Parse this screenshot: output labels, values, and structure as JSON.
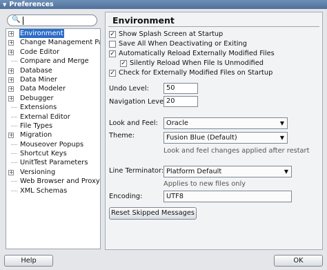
{
  "window": {
    "title": "Preferences"
  },
  "search": {
    "icon": "binoculars-icon",
    "value": ""
  },
  "tree": {
    "nodes": [
      {
        "label": "Environment",
        "expandable": true,
        "selected": true
      },
      {
        "label": "Change Management Param",
        "expandable": true
      },
      {
        "label": "Code Editor",
        "expandable": true
      },
      {
        "label": "Compare and Merge",
        "expandable": false
      },
      {
        "label": "Database",
        "expandable": true
      },
      {
        "label": "Data Miner",
        "expandable": true
      },
      {
        "label": "Data Modeler",
        "expandable": true
      },
      {
        "label": "Debugger",
        "expandable": true
      },
      {
        "label": "Extensions",
        "expandable": false
      },
      {
        "label": "External Editor",
        "expandable": false
      },
      {
        "label": "File Types",
        "expandable": false
      },
      {
        "label": "Migration",
        "expandable": true
      },
      {
        "label": "Mouseover Popups",
        "expandable": false
      },
      {
        "label": "Shortcut Keys",
        "expandable": false
      },
      {
        "label": "UnitTest Parameters",
        "expandable": false
      },
      {
        "label": "Versioning",
        "expandable": true
      },
      {
        "label": "Web Browser and Proxy",
        "expandable": false
      },
      {
        "label": "XML Schemas",
        "expandable": false
      }
    ]
  },
  "panel": {
    "title": "Environment",
    "checkboxes": [
      {
        "label": "Show Splash Screen at Startup",
        "checked": true
      },
      {
        "label": "Save All When Deactivating or Exiting",
        "checked": false
      },
      {
        "label": "Automatically Reload Externally Modified Files",
        "checked": true
      },
      {
        "label": "Silently Reload When File Is Unmodified",
        "checked": true
      },
      {
        "label": "Check for Externally Modified Files on Startup",
        "checked": true
      }
    ],
    "undo_level": {
      "label": "Undo Level:",
      "value": "50"
    },
    "navigation_level": {
      "label": "Navigation Level:",
      "value": "20"
    },
    "look_and_feel": {
      "label": "Look and Feel:",
      "value": "Oracle"
    },
    "theme": {
      "label": "Theme:",
      "value": "Fusion Blue (Default)",
      "note": "Look and feel changes applied after restart"
    },
    "line_terminator": {
      "label": "Line Terminator:",
      "value": "Platform Default",
      "note": "Applies to new files only"
    },
    "encoding": {
      "label": "Encoding:",
      "value": "UTF8"
    },
    "reset_button": "Reset Skipped Messages"
  },
  "footer": {
    "help": "Help",
    "ok": "OK"
  }
}
